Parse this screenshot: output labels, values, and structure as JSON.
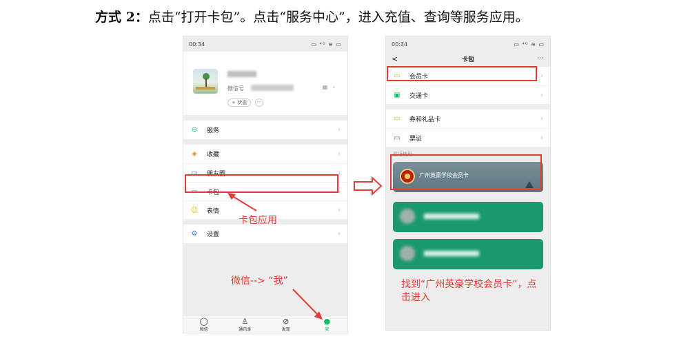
{
  "heading": {
    "prefix": "方式 2：",
    "text": "点击“打开卡包”。点击“服务中心”，进入充值、查询等服务应用。"
  },
  "phone1": {
    "status_time": "00:34",
    "status_right": "▭ ⁴ᴳ ≋ ▭",
    "wechat_id_label": "微信号",
    "qr_icon": "qr-icon",
    "status_chip": "+ 状态",
    "more_chip": "···",
    "menu": [
      {
        "label": "服务",
        "icon": "service-icon"
      },
      {
        "label": "收藏",
        "icon": "favorites-icon"
      },
      {
        "label": "朋友圈",
        "icon": "moments-icon"
      },
      {
        "label": "卡包",
        "icon": "card-wallet-icon"
      },
      {
        "label": "表情",
        "icon": "emoji-icon"
      },
      {
        "label": "设置",
        "icon": "settings-icon"
      }
    ],
    "tabs": [
      {
        "label": "微信",
        "icon": "chat-icon"
      },
      {
        "label": "通讯录",
        "icon": "contacts-icon"
      },
      {
        "label": "发现",
        "icon": "discover-icon"
      },
      {
        "label": "我",
        "icon": "me-icon"
      }
    ],
    "annotation_cardwallet": "卡包应用",
    "annotation_me": "微信-->  “我”"
  },
  "phone2": {
    "status_time": "00:34",
    "status_right": "▭ ⁴ᴳ ≋ ▭",
    "title": "卡包",
    "back": "<",
    "more": "···",
    "group1": [
      {
        "label": "会员卡",
        "icon": "member-card-icon"
      },
      {
        "label": "交通卡",
        "icon": "transit-card-icon"
      }
    ],
    "group2": [
      {
        "label": "券和礼品卡",
        "icon": "coupon-icon"
      },
      {
        "label": "票证",
        "icon": "ticket-icon"
      }
    ],
    "recent_label": "最近使用",
    "card1_name": "广州英豪学校会员卡",
    "annotation": "找到“广州英豪学校会员卡”，点击进入"
  },
  "colors": {
    "annotation_red": "#e53935",
    "wechat_green": "#07c160",
    "card_green": "#1a9a6c",
    "card_gray": "#5d7680"
  }
}
